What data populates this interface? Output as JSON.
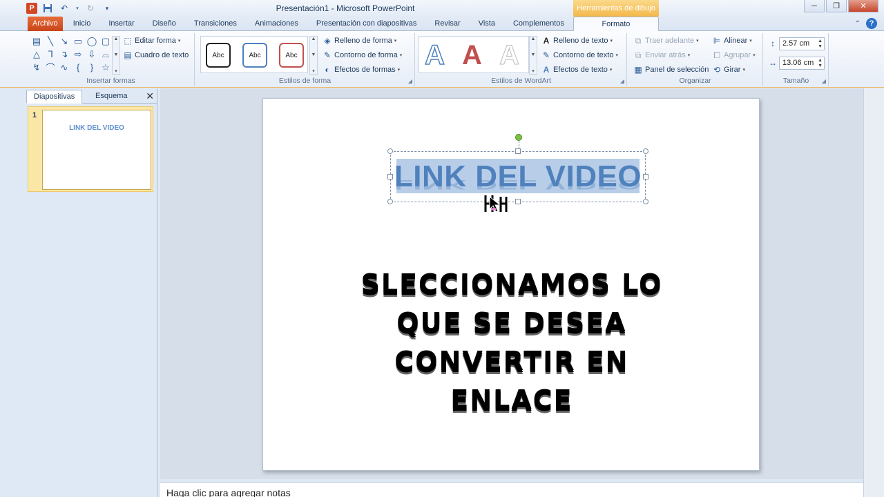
{
  "window": {
    "title": "Presentación1 - Microsoft PowerPoint",
    "contextual_band": "Herramientas de dibujo",
    "minimize": "─",
    "maximize": "❐",
    "close": "✕"
  },
  "qat": [
    "save-icon",
    "undo-icon",
    "redo-icon",
    "customize-icon"
  ],
  "tabs": [
    {
      "label": "Archivo",
      "kind": "file"
    },
    {
      "label": "Inicio"
    },
    {
      "label": "Insertar"
    },
    {
      "label": "Diseño"
    },
    {
      "label": "Transiciones"
    },
    {
      "label": "Animaciones"
    },
    {
      "label": "Presentación con diapositivas"
    },
    {
      "label": "Revisar"
    },
    {
      "label": "Vista"
    },
    {
      "label": "Complementos"
    },
    {
      "label": "Formato",
      "active": true
    }
  ],
  "ribbon": {
    "insert_shapes": {
      "label": "Insertar formas",
      "edit_shape": "Editar forma",
      "text_box": "Cuadro de texto"
    },
    "shape_styles": {
      "label": "Estilos de forma",
      "sample": "Abc",
      "fill": "Relleno de forma",
      "outline": "Contorno de forma",
      "effects": "Efectos de formas"
    },
    "wordart_styles": {
      "label": "Estilos de WordArt",
      "sample": "A",
      "text_fill": "Relleno de texto",
      "text_outline": "Contorno de texto",
      "text_effects": "Efectos de texto"
    },
    "arrange": {
      "label": "Organizar",
      "bring_forward": "Traer adelante",
      "send_backward": "Enviar atrás",
      "selection_pane": "Panel de selección",
      "align": "Alinear",
      "group": "Agrupar",
      "rotate": "Girar"
    },
    "size": {
      "label": "Tamaño",
      "height": "2.57 cm",
      "width": "13.06 cm"
    }
  },
  "left_pane": {
    "tabs": [
      "Diapositivas",
      "Esquema"
    ],
    "close": "✕",
    "slide_number": "1",
    "thumb_title": "LINK DEL VIDEO"
  },
  "slide": {
    "title": "LINK DEL VIDEO",
    "body_lines": [
      "SLECCIONAMOS LO",
      "QUE SE DESEA",
      "CONVERTIR EN",
      "ENLACE"
    ]
  },
  "notes": {
    "placeholder": "Haga clic para agregar notas"
  },
  "colors": {
    "accent": "#4f81bd",
    "file_tab": "#d24726",
    "contextual": "#f4b84a"
  }
}
